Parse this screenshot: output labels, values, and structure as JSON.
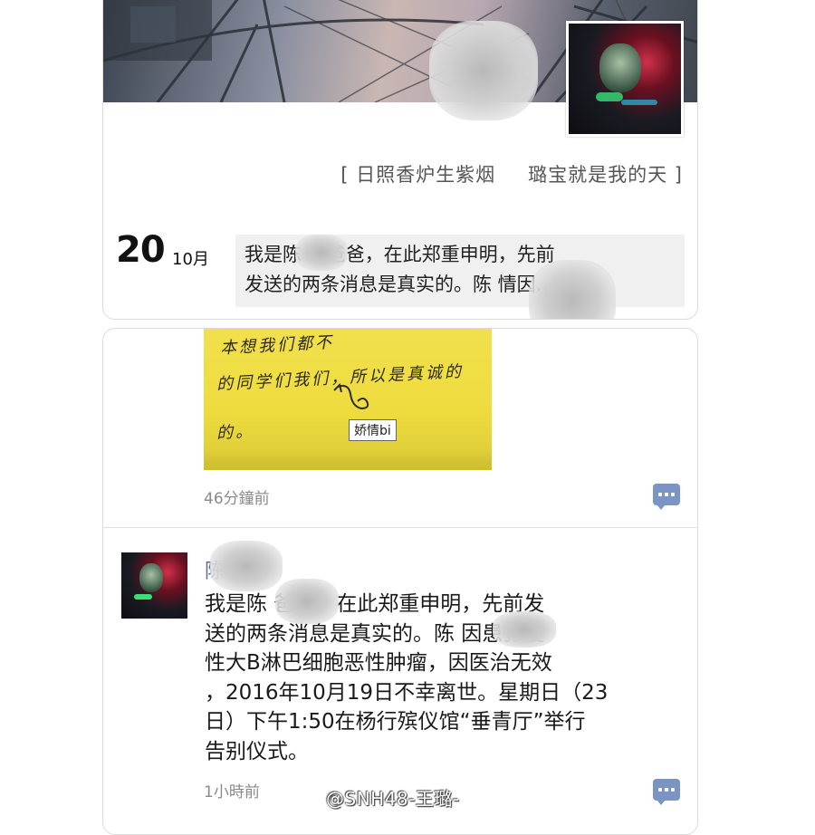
{
  "profile": {
    "signature_left": "[ 日照香炉生紫烟",
    "signature_right": "璐宝就是我的天 ]",
    "avatar": "profile-avatar"
  },
  "latest_post": {
    "day": "20",
    "month": "10月",
    "preview_line1": "我是陈  情爸爸，在此郑重申明，先前",
    "preview_line2": "发送的两条消息是真实的。陈  情因…"
  },
  "photo_post": {
    "image_text_line1": "本想我们都不",
    "image_text_line2": "的同学们我们，所以是真诚的",
    "image_text_line3": "的。",
    "image_label": "娇情bi",
    "time_ago": "46分鐘前",
    "comment_icon": "comment-icon"
  },
  "text_post": {
    "author": "陈",
    "lines": [
      "我是陈  爸爸，在此郑重申明，先前发",
      "送的两条消息是真实的。陈  因患弥漫",
      "性大B淋巴细胞恶性肿瘤，因医治无效",
      "，2016年10月19日不幸离世。星期日（23",
      "日）下午1:50在杨行殡仪馆“垂青厅”举行",
      "告别仪式。"
    ],
    "time_ago": "1小時前",
    "comment_icon": "comment-icon"
  },
  "watermark": "@SNH48-王璐-",
  "colors": {
    "link_blue": "#5b6f97",
    "comment_icon": "#7a95c4",
    "preview_bg": "#f0f0f0"
  }
}
